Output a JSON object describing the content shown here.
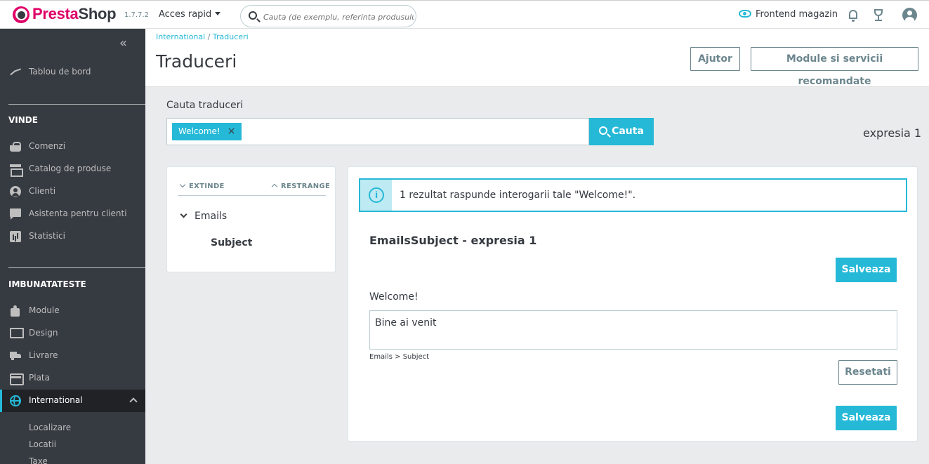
{
  "header": {
    "brand_presta": "Presta",
    "brand_shop": "Shop",
    "version": "1.7.7.2",
    "quick_access": "Acces rapid",
    "search_placeholder": "Cauta (de exemplu, referinta produsului",
    "frontend_link": "Frontend magazin"
  },
  "sidebar": {
    "collapse_icon": "«",
    "dashboard": "Tablou de bord",
    "section_sell": "VINDE",
    "sell_items": [
      "Comenzi",
      "Catalog de produse",
      "Clienti",
      "Asistenta pentru clienti",
      "Statistici"
    ],
    "section_improve": "IMBUNATATESTE",
    "improve_items": [
      "Module",
      "Design",
      "Livrare",
      "Plata",
      "International"
    ],
    "sub_items": [
      "Localizare",
      "Locatii",
      "Taxe"
    ]
  },
  "page": {
    "breadcrumb_parent": "International",
    "breadcrumb_sep": " / ",
    "breadcrumb_current": "Traduceri",
    "title": "Traduceri",
    "help_button": "Ajutor",
    "modules_button": "Module si servicii recomandate"
  },
  "search": {
    "label": "Cauta traduceri",
    "tag": "Welcome!",
    "tag_remove": "×",
    "button": "Cauta",
    "expression_count": "expresia 1"
  },
  "tree": {
    "expand": "EXTINDE",
    "collapse": "RESTRANGE",
    "domain": "Emails",
    "subdomain": "Subject"
  },
  "results": {
    "info_icon": "i",
    "alert_message": "1 rezultat raspunde interogarii tale \"Welcome!\".",
    "title": "EmailsSubject - expresia 1",
    "save_button": "Salveaza",
    "original_text": "Welcome!",
    "translation_value": "Bine ai venit",
    "translation_path": "Emails > Subject",
    "reset_button": "Resetati"
  },
  "colors": {
    "accent": "#25b9d7",
    "sidebar_bg": "#363a41",
    "brand": "#df0067"
  }
}
